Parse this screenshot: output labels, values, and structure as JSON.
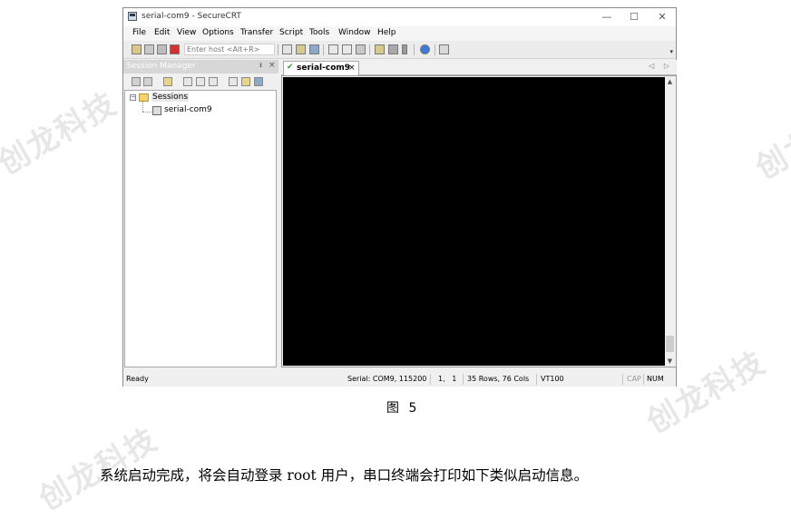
{
  "watermark": "创龙科技",
  "window": {
    "title": "serial-com9 - SecureCRT",
    "controls": {
      "minimize": "—",
      "maximize": "☐",
      "close": "✕"
    }
  },
  "menu": [
    "File",
    "Edit",
    "View",
    "Options",
    "Transfer",
    "Script",
    "Tools",
    "Window",
    "Help"
  ],
  "toolbar": {
    "host_placeholder": "Enter host <Alt+R>"
  },
  "session_manager": {
    "title": "Session Manager",
    "pin": "ᵻ",
    "close": "×",
    "tree": {
      "root": "Sessions",
      "expander": "−",
      "children": [
        "serial-com9"
      ]
    }
  },
  "tab": {
    "label": "serial-com9",
    "close": "×",
    "check": "✔",
    "arrows": "◁ ▷"
  },
  "scrollbar": {
    "up": "▲",
    "down": "▼"
  },
  "status": {
    "ready": "Ready",
    "serial": "Serial: COM9, 115200",
    "cursor": "1,   1",
    "size": "35 Rows, 76 Cols",
    "emulation": "VT100",
    "cap": "CAP",
    "num": "NUM"
  },
  "caption": "图 5",
  "body_text": "系统启动完成，将会自动登录 root 用户，串口终端会打印如下类似启动信息。"
}
